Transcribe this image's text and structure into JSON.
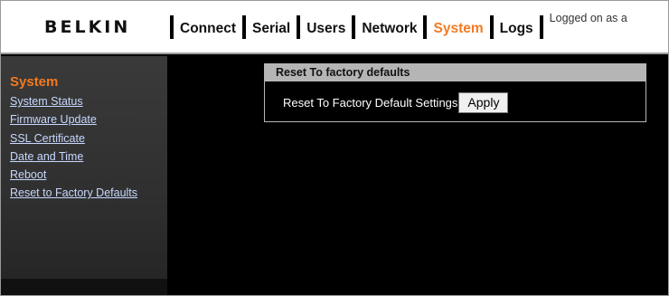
{
  "header": {
    "brand": "BELKIN",
    "nav": [
      {
        "label": "Connect"
      },
      {
        "label": "Serial"
      },
      {
        "label": "Users"
      },
      {
        "label": "Network"
      },
      {
        "label": "System",
        "active": true
      },
      {
        "label": "Logs"
      }
    ],
    "logged_in_text": "Logged on as a"
  },
  "sidebar": {
    "title": "System",
    "items": [
      {
        "label": "System Status"
      },
      {
        "label": "Firmware Update"
      },
      {
        "label": "SSL Certificate"
      },
      {
        "label": "Date and Time"
      },
      {
        "label": "Reboot"
      },
      {
        "label": "Reset to Factory Defaults"
      }
    ]
  },
  "panel": {
    "title": "Reset To factory defaults",
    "row_label": "Reset To Factory Default Settings",
    "button_label": "Apply"
  },
  "colors": {
    "accent": "#f47a20",
    "link": "#c7d8ff",
    "panel_header": "#b5b5b5",
    "background": "#000000"
  }
}
